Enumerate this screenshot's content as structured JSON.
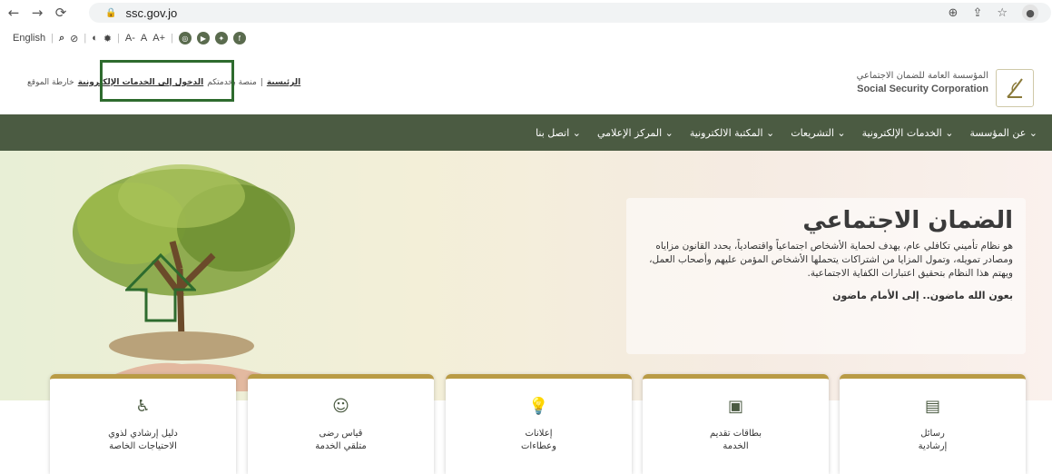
{
  "browser": {
    "url": "ssc.gov.jo"
  },
  "accessibility": {
    "language": "English",
    "font_small": "A-",
    "font_normal": "A",
    "font_large": "A+"
  },
  "header": {
    "org_name_ar": "المؤسسة العامة للضمان الاجتماعي",
    "org_name_en": "Social Security Corporation",
    "link_home": "الرئيسية",
    "link_separator": "|",
    "link_platform": "منصة بخدمتكم",
    "link_eservices_login": "الدخول إلى الخدمات الإلكترونية",
    "link_sitemap": "خارطة الموقع"
  },
  "nav": {
    "items": [
      "عن المؤسسة",
      "الخدمات الإلكترونية",
      "التشريعات",
      "المكتبة الالكترونية",
      "المركز الإعلامي",
      "اتصل بنا"
    ]
  },
  "hero": {
    "title": "الضمان الاجتماعي",
    "description": "هو نظام تأميني تكافلي عام، يهدف لحماية الأشخاص اجتماعياً واقتصادياً، يحدد القانون مزاياه ومصادر تمويله، وتمول المزايا من اشتراكات يتحملها الأشخاص المؤمن عليهم وأصحاب العمل، ويهتم هذا النظام بتحقيق اعتبارات الكفاية الاجتماعية.",
    "tagline": "بعون الله ماضون.. إلى الأمام ماضون"
  },
  "cards": [
    {
      "icon": "message-icon",
      "line1": "رسائل",
      "line2": "إرشادية"
    },
    {
      "icon": "id-card-icon",
      "line1": "بطاقات تقديم",
      "line2": "الخدمة"
    },
    {
      "icon": "lightbulb-icon",
      "line1": "إعلانات",
      "line2": "وعطاءات"
    },
    {
      "icon": "smiley-icon",
      "line1": "قياس رضى",
      "line2": "متلقي الخدمة"
    },
    {
      "icon": "accessibility-icon",
      "line1": "دليل إرشادي لذوي",
      "line2": "الاحتياجات الخاصة"
    }
  ],
  "colors": {
    "nav_bg": "#4b5b42",
    "card_top": "#b99b45",
    "highlight": "#2e6b2e"
  }
}
